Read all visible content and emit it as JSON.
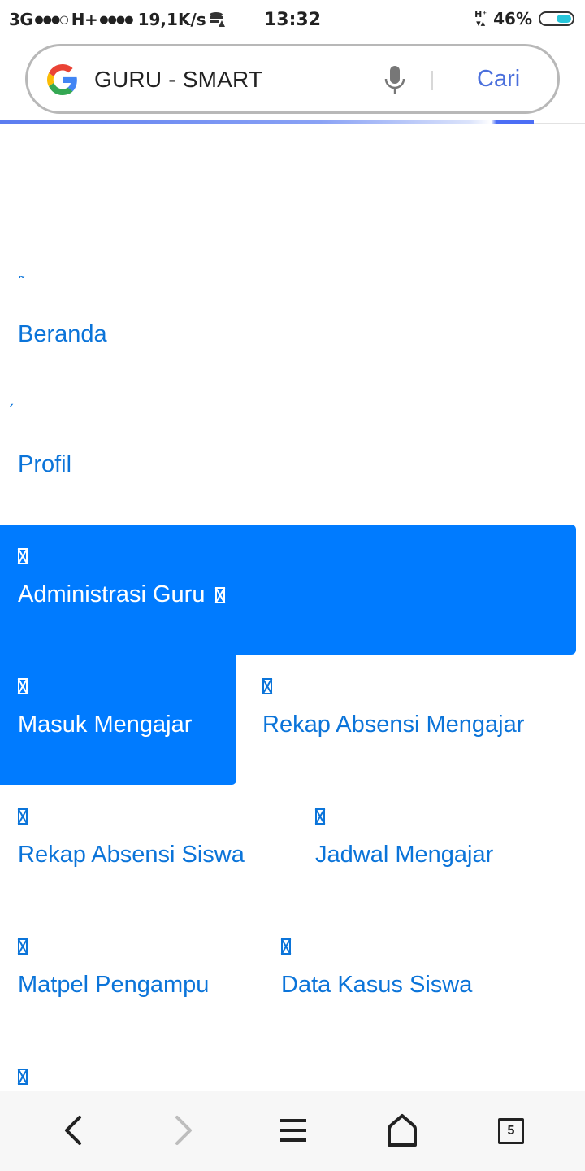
{
  "status_bar": {
    "network_1": "3G",
    "network_2": "H+",
    "speed": "19,1K/s",
    "time": "13:32",
    "battery_percent": "46%"
  },
  "search": {
    "query": "GURU - SMART",
    "search_button": "Cari"
  },
  "menu": {
    "items": [
      {
        "icon": "˜",
        "label": "Beranda"
      },
      {
        "icon": "´",
        "label": "Profil"
      },
      {
        "icon": "",
        "label": "Administrasi Guru"
      },
      {
        "icon": "",
        "label": "Masuk Mengajar"
      },
      {
        "icon": "",
        "label": "Rekap Absensi Mengajar"
      },
      {
        "icon": "",
        "label": "Rekap Absensi Siswa"
      },
      {
        "icon": "",
        "label": "Jadwal Mengajar"
      },
      {
        "icon": "",
        "label": "Matpel Pengampu"
      },
      {
        "icon": "",
        "label": "Data Kasus Siswa"
      }
    ]
  },
  "bottom_nav": {
    "tab_count": "5"
  },
  "colors": {
    "accent": "#007bff",
    "link": "#0b74d9",
    "search_button": "#4a6fdc",
    "battery_fill": "#26c6da"
  }
}
